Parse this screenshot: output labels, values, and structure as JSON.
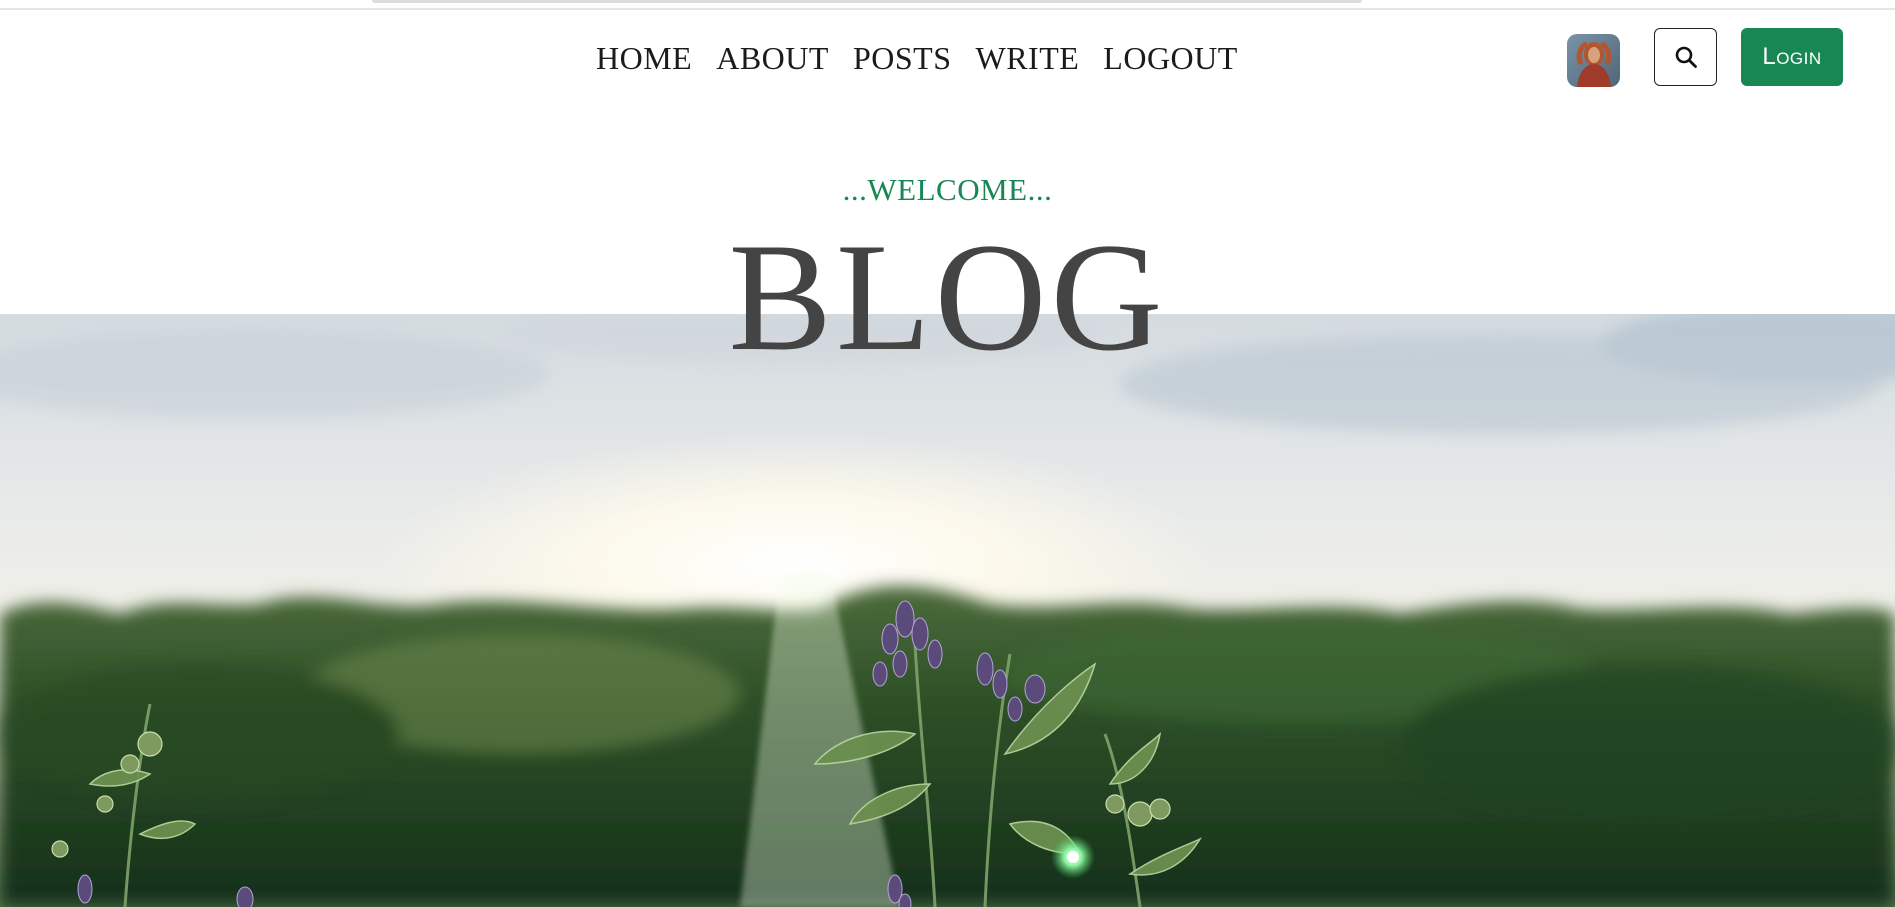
{
  "nav": {
    "items": [
      {
        "label": "HOME"
      },
      {
        "label": "ABOUT"
      },
      {
        "label": "POSTS"
      },
      {
        "label": "WRITE"
      },
      {
        "label": "LOGOUT"
      }
    ]
  },
  "header": {
    "avatar_icon": "profile-photo",
    "search_icon": "search-icon",
    "login_label": "Login"
  },
  "hero": {
    "welcome": "...WELCOME...",
    "title": "BLOG"
  },
  "colors": {
    "accent": "#198754",
    "title": "#444444",
    "nav_text": "#1b1b1b"
  }
}
